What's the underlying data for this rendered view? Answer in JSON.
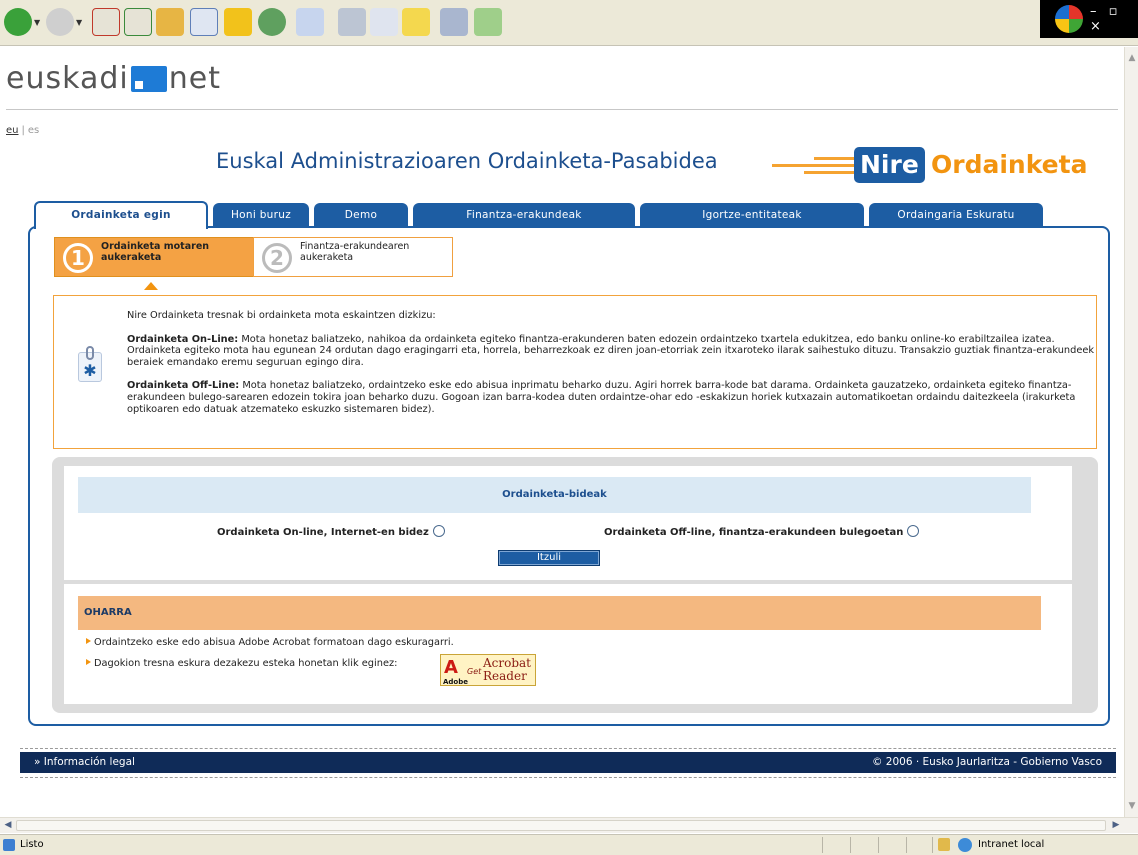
{
  "toolbar": {
    "buttons": [
      {
        "name": "back-button",
        "icon": "back-arrow-icon",
        "color": "#3aa13a"
      },
      {
        "name": "forward-button",
        "icon": "forward-arrow-icon",
        "color": "#bfbfbf"
      },
      {
        "name": "stop-button",
        "icon": "stop-icon",
        "color": "#d0382b"
      },
      {
        "name": "refresh-button",
        "icon": "refresh-icon",
        "color": "#3b8a3b"
      },
      {
        "name": "home-button",
        "icon": "home-icon",
        "color": "#e7b544"
      },
      {
        "name": "search-button",
        "icon": "search-icon",
        "color": "#5f7fb8"
      },
      {
        "name": "favorites-button",
        "icon": "star-icon",
        "color": "#f2c21b"
      },
      {
        "name": "history-button",
        "icon": "history-icon",
        "color": "#3d8a3d"
      },
      {
        "name": "mail-button",
        "icon": "mail-icon",
        "color": "#7a9ad1"
      },
      {
        "name": "print-button",
        "icon": "printer-icon",
        "color": "#8e9bb0"
      },
      {
        "name": "edit-button",
        "icon": "edit-icon",
        "color": "#6f8fbf"
      },
      {
        "name": "notes-button",
        "icon": "sticky-note-icon",
        "color": "#f4d84e"
      },
      {
        "name": "research-button",
        "icon": "research-icon",
        "color": "#5b6e9a"
      },
      {
        "name": "messenger-button",
        "icon": "messenger-icon",
        "color": "#5aa53b"
      }
    ]
  },
  "site": {
    "logo_left": "euskadi",
    "logo_right": "net",
    "languages": {
      "eu": "eu",
      "separator": "|",
      "es": "es"
    },
    "headline": "Euskal Administrazioaren Ordainketa-Pasabidea",
    "brand_nire": "Nire",
    "brand_ordainketa": "Ordainketa"
  },
  "tabs": [
    {
      "label": "Ordainketa egin",
      "active": true
    },
    {
      "label": "Honi buruz",
      "active": false
    },
    {
      "label": "Demo",
      "active": false
    },
    {
      "label": "Finantza-erakundeak",
      "active": false
    },
    {
      "label": "Igortze-entitateak",
      "active": false
    },
    {
      "label": "Ordaingaria Eskuratu",
      "active": false
    }
  ],
  "steps": [
    {
      "number": "1",
      "label": "Ordainketa motaren aukeraketa",
      "state": "active"
    },
    {
      "number": "2",
      "label": "Finantza-erakundearen aukeraketa",
      "state": "pending"
    }
  ],
  "info": {
    "intro": "Nire Ordainketa tresnak bi ordainketa mota eskaintzen dizkizu:",
    "online_title": "Ordainketa On-Line:",
    "online_text": "Mota honetaz baliatzeko, nahikoa da ordainketa egiteko finantza-erakunderen baten edozein ordaintzeko txartela edukitzea, edo banku online-ko erabiltzailea izatea. Ordainketa egiteko mota hau egunean 24 ordutan dago eragingarri eta, horrela, beharrezkoak ez diren joan-etorriak zein itxaroteko ilarak saihestuko dituzu. Transakzio guztiak finantza-erakundeek beraiek emandako eremu seguruan egingo dira.",
    "offline_title": "Ordainketa Off-Line:",
    "offline_text": "Mota honetaz baliatzeko, ordaintzeko eske edo abisua inprimatu beharko duzu. Agiri horrek barra-kode bat darama. Ordainketa gauzatzeko, ordainketa egiteko finantza-erakundeen bulego-sarearen edozein tokira joan beharko duzu. Gogoan izan barra-kodea duten ordaintze-ohar edo -eskakizun horiek kutxazain automatikoetan ordaindu daitezkeela (irakurketa optikoaren edo datuak atzemateko eskuzko sistemaren bidez)."
  },
  "methods": {
    "title": "Ordainketa-bideak",
    "online_option": "Ordainketa On-line, Internet-en bidez",
    "offline_option": "Ordainketa Off-line, finantza-erakundeen bulegoetan",
    "back_button": "Itzuli"
  },
  "note": {
    "title": "OHARRA",
    "items": [
      "Ordaintzeko eske edo abisua Adobe Acrobat formatoan dago eskuragarri.",
      "Dagokion tresna eskura dezakezu esteka honetan klik eginez:"
    ],
    "acrobat_adobe": "Adobe",
    "acrobat_get": "Get",
    "acrobat_name_1": "Acrobat",
    "acrobat_name_2": "Reader"
  },
  "footer": {
    "legal": "» Información legal",
    "copyright": "© 2006 · Eusko Jaurlaritza - Gobierno Vasco"
  },
  "statusbar": {
    "status": "Listo",
    "zone": "Intranet local"
  },
  "colors": {
    "primary_blue": "#1d5da3",
    "accent_orange": "#f29410",
    "footer_navy": "#0f2b58"
  }
}
